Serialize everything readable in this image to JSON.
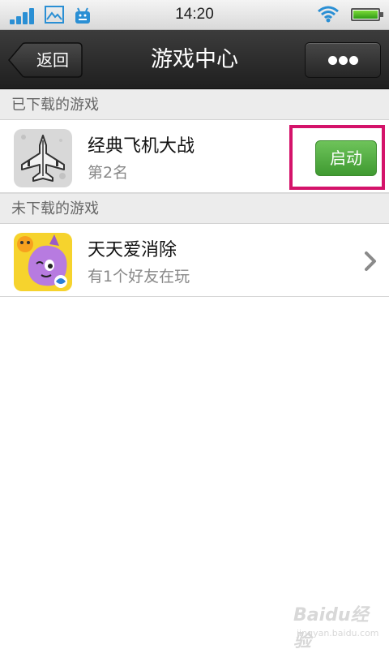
{
  "status_bar": {
    "time": "14:20",
    "icons": [
      "signal-icon",
      "image-icon",
      "android-store-icon",
      "wifi-icon",
      "battery-icon"
    ]
  },
  "nav": {
    "back_label": "返回",
    "title": "游戏中心",
    "more_icon": "more-dots-icon"
  },
  "sections": {
    "downloaded": {
      "header": "已下载的游戏",
      "games": [
        {
          "name": "经典飞机大战",
          "subtitle": "第2名",
          "action_label": "启动",
          "icon": "plane-game-icon"
        }
      ]
    },
    "not_downloaded": {
      "header": "未下载的游戏",
      "games": [
        {
          "name": "天天爱消除",
          "subtitle": "有1个好友在玩",
          "icon": "match-game-icon"
        }
      ]
    }
  },
  "watermark": {
    "brand": "Baidu经验",
    "url": "jingyan.baidu.com"
  },
  "colors": {
    "nav_bg": "#2a2a2a",
    "launch_button": "#4fae3f",
    "highlight": "#d4136a",
    "status_blue": "#2a8fd4"
  }
}
